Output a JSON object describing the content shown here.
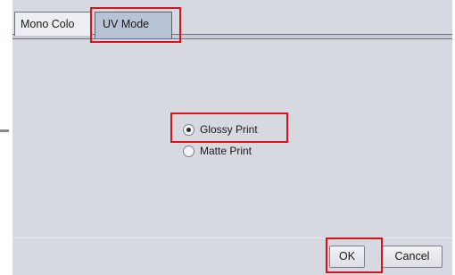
{
  "tabs": [
    {
      "label": "Mono Colo",
      "selected": false
    },
    {
      "label": "UV Mode",
      "selected": true
    }
  ],
  "uv_mode": {
    "options": [
      {
        "label": "Glossy Print",
        "selected": true
      },
      {
        "label": "Matte Print",
        "selected": false
      }
    ]
  },
  "footer": {
    "ok_label": "OK",
    "cancel_label": "Cancel"
  },
  "colors": {
    "panel_bg": "#d7d9e1",
    "selected_tab_bg": "#b9c3d6",
    "highlight": "#d8121a"
  }
}
